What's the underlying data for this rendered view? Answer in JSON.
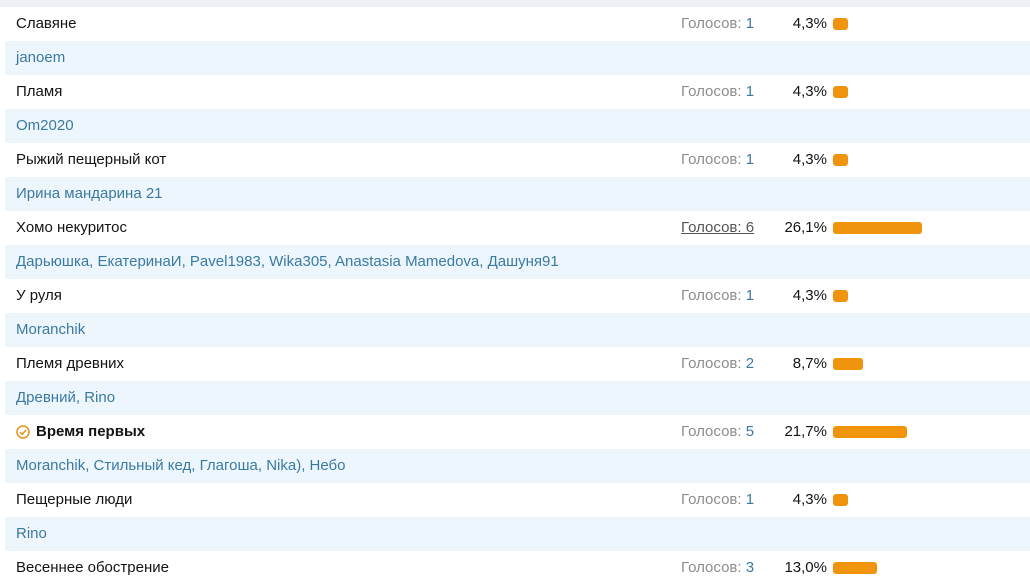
{
  "poll": {
    "votes_prefix": "Голосов: ",
    "accent_color": "#f0940e",
    "options": [
      {
        "label": "Славяне",
        "votes": "1",
        "percent": "4,3%",
        "share": 4.3,
        "voters": "janoem",
        "winner": false,
        "votes_link": false
      },
      {
        "label": "Пламя",
        "votes": "1",
        "percent": "4,3%",
        "share": 4.3,
        "voters": "Om2020",
        "winner": false,
        "votes_link": false
      },
      {
        "label": "Рыжий пещерный кот",
        "votes": "1",
        "percent": "4,3%",
        "share": 4.3,
        "voters": "Ирина мандарина 21",
        "winner": false,
        "votes_link": false
      },
      {
        "label": "Хомо некуритос",
        "votes": "6",
        "percent": "26,1%",
        "share": 26.1,
        "voters": "Дарьюшка, ЕкатеринаИ, Pavel1983, Wika305, Anastasia Mamedova, Дашуня91",
        "winner": false,
        "votes_link": true
      },
      {
        "label": "У руля",
        "votes": "1",
        "percent": "4,3%",
        "share": 4.3,
        "voters": "Moranchik",
        "winner": false,
        "votes_link": false
      },
      {
        "label": "Племя древних",
        "votes": "2",
        "percent": "8,7%",
        "share": 8.7,
        "voters": "Древний, Rino",
        "winner": false,
        "votes_link": false
      },
      {
        "label": "Время первых",
        "votes": "5",
        "percent": "21,7%",
        "share": 21.7,
        "voters": "Moranchik, Стильный кед, Глагоша, Nika), Небо",
        "winner": true,
        "votes_link": false
      },
      {
        "label": "Пещерные люди",
        "votes": "1",
        "percent": "4,3%",
        "share": 4.3,
        "voters": "Rino",
        "winner": false,
        "votes_link": false
      },
      {
        "label": "Весеннее обострение",
        "votes": "3",
        "percent": "13,0%",
        "share": 13.0,
        "voters": "",
        "winner": false,
        "votes_link": false
      }
    ]
  }
}
